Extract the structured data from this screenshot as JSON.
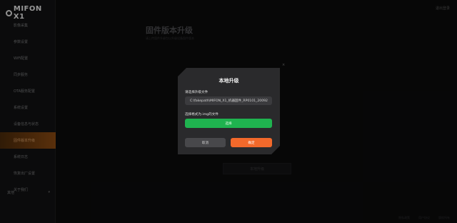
{
  "app": {
    "logo_text": "MIFON X1"
  },
  "sidebar": {
    "items": [
      {
        "label": "影像采集",
        "active": false
      },
      {
        "label": "参数设置",
        "active": false
      },
      {
        "label": "WiFi配置",
        "active": false
      },
      {
        "label": "同步服务",
        "active": false
      },
      {
        "label": "OTA服务配置",
        "active": false
      },
      {
        "label": "系统设置",
        "active": false
      },
      {
        "label": "设备信息与状态",
        "active": false
      },
      {
        "label": "固件版本升级",
        "active": true
      },
      {
        "label": "系统日志",
        "active": false
      },
      {
        "label": "恢复出厂设置",
        "active": false
      },
      {
        "label": "关于我们",
        "active": false
      }
    ],
    "footer_label": "其他",
    "footer_caret": "▾"
  },
  "top_right_text": "退出登录",
  "main": {
    "title": "固件版本升级",
    "subtitle": "请上传固件升级包以升级设备固件版本",
    "background_button": "本地升级",
    "bottom_links": [
      "隐私政策",
      "用户协议",
      "版权所有"
    ]
  },
  "modal": {
    "title": "本地升级",
    "file_label": "请选择升级文件",
    "file_path": "C:\\fakepath\\MIFON_X1_机器固件_RP0101_20092",
    "format_hint": "选择格式为.img的文件",
    "select_button": "选择",
    "cancel_button": "取消",
    "confirm_button": "确定",
    "close_icon": "×"
  },
  "colors": {
    "active_sidebar": "#8a4a12",
    "select_green": "#1fb34f",
    "confirm_orange": "#f2692b"
  }
}
